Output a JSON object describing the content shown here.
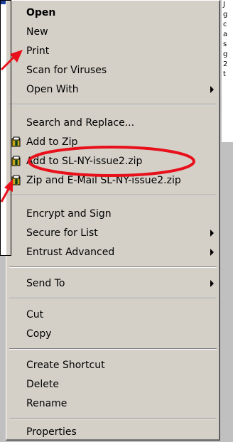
{
  "menu": {
    "items": [
      {
        "label": "Open",
        "bold": true
      },
      {
        "label": "New"
      },
      {
        "label": "Print"
      },
      {
        "label": "Scan for Viruses"
      },
      {
        "label": "Open With",
        "submenu": true
      },
      {
        "label": "Search and Replace..."
      },
      {
        "label": "Add to Zip",
        "icon": "winzip-icon"
      },
      {
        "label": "Add to SL-NY-issue2.zip",
        "icon": "winzip-icon"
      },
      {
        "label": "Zip and E-Mail SL-NY-issue2.zip",
        "icon": "winzip-icon"
      },
      {
        "label": "Encrypt and Sign"
      },
      {
        "label": "Secure for List",
        "submenu": true
      },
      {
        "label": "Entrust Advanced",
        "submenu": true
      },
      {
        "label": "Send To",
        "submenu": true
      },
      {
        "label": "Cut"
      },
      {
        "label": "Copy"
      },
      {
        "label": "Create Shortcut"
      },
      {
        "label": "Delete"
      },
      {
        "label": "Rename"
      },
      {
        "label": "Properties"
      }
    ]
  },
  "background_right_text": [
    "J",
    "g",
    "c",
    "a",
    "s",
    "g",
    "2",
    "t"
  ],
  "colors": {
    "menu_bg": "#d4d0c8",
    "annotation_red": "#e8101a",
    "title_blue": "#1b3f9b"
  }
}
